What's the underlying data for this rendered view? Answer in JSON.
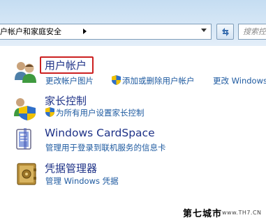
{
  "address_bar": {
    "breadcrumb": "户帐户和家庭安全",
    "search_placeholder": "搜索控"
  },
  "categories": [
    {
      "title": "用户帐户",
      "icon": "users-icon",
      "links": [
        "更改帐户图片",
        "添加或删除用户帐户",
        "更改 Windows"
      ]
    },
    {
      "title": "家长控制",
      "icon": "parental-controls-icon",
      "links": [
        "为所有用户设置家长控制"
      ]
    },
    {
      "title": "Windows CardSpace",
      "icon": "cardspace-icon",
      "links": [
        "管理用于登录到联机服务的信息卡"
      ]
    },
    {
      "title": "凭据管理器",
      "icon": "credential-vault-icon",
      "links": [
        "管理 Windows 凭据"
      ]
    }
  ],
  "watermark": {
    "text": "第七城市",
    "url": "www.TH7.CN"
  },
  "colors": {
    "title": "#1e3287",
    "link": "#1e5aa0",
    "highlight": "#cc2020"
  }
}
